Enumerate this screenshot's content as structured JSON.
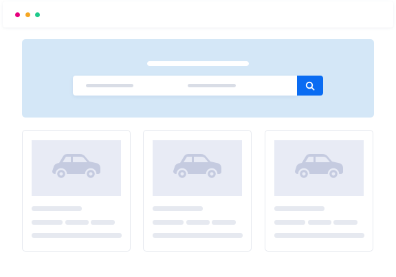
{
  "window": {
    "controls": [
      {
        "name": "close",
        "color": "#e6007e"
      },
      {
        "name": "minimize",
        "color": "#f5a623"
      },
      {
        "name": "maximize",
        "color": "#1ec98b"
      }
    ]
  },
  "colors": {
    "hero_bg": "#d4e7f7",
    "accent": "#0a6cf2",
    "skeleton": "#e6e9f0",
    "skeleton_dark": "#d9dde6",
    "thumb_bg": "#e8ebf5",
    "car_icon": "#c5cbe0",
    "white": "#ffffff"
  },
  "search": {
    "icon": "search-icon",
    "placeholder": ""
  },
  "listings": [
    {
      "icon": "car-icon"
    },
    {
      "icon": "car-icon"
    },
    {
      "icon": "car-icon"
    }
  ]
}
